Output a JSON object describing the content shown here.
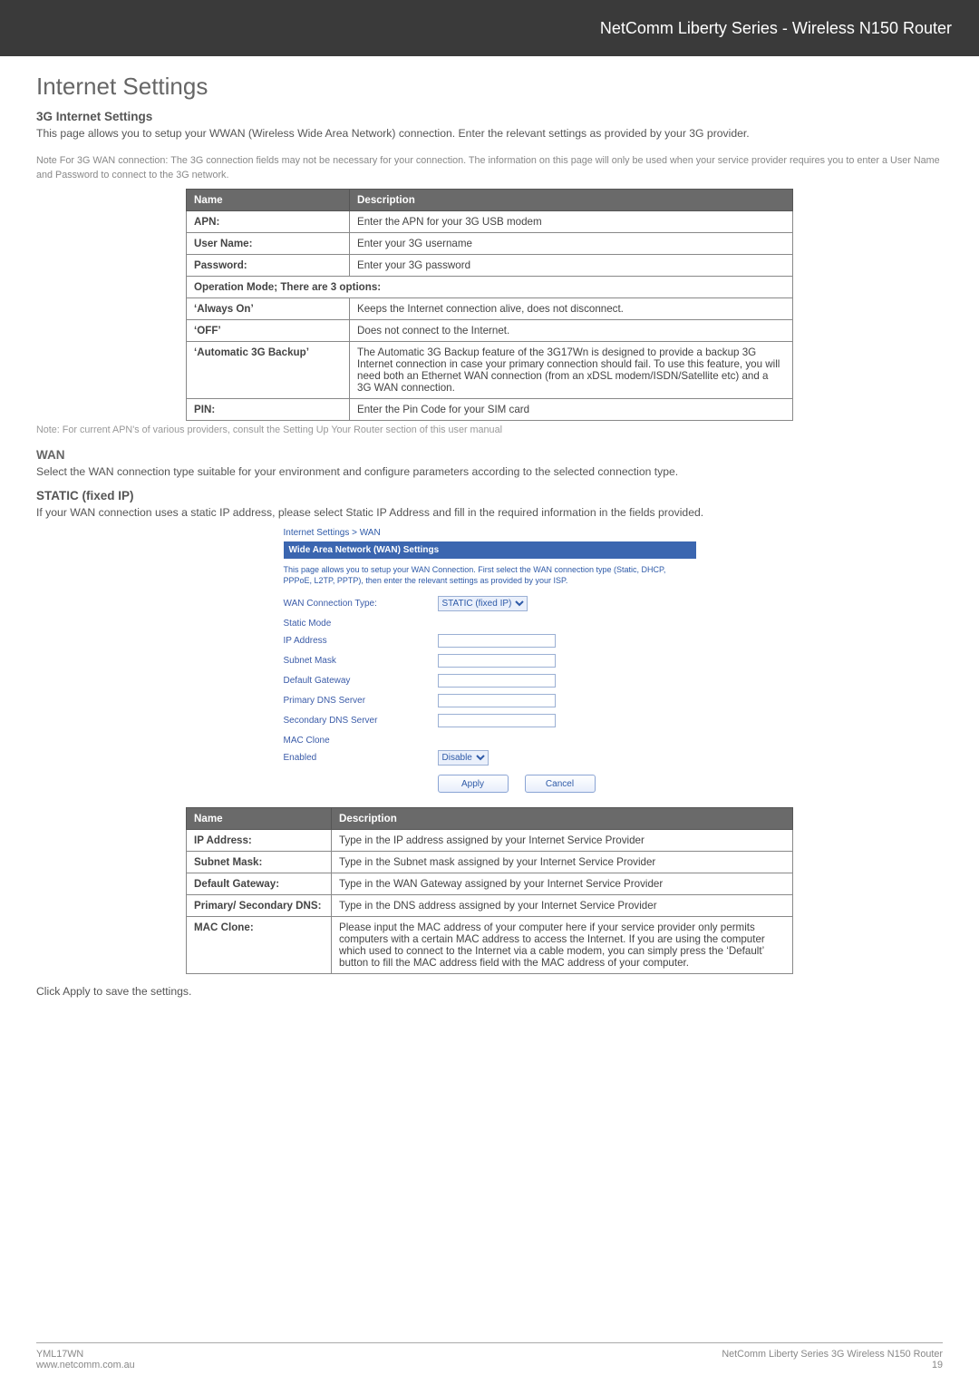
{
  "banner": {
    "title": "NetComm Liberty Series - Wireless N150 Router"
  },
  "h1": "Internet Settings",
  "sec_3g": {
    "title": "3G Internet Settings",
    "intro": "This page allows you to setup your WWAN (Wireless Wide Area Network) connection. Enter the relevant settings as provided by your 3G provider.",
    "note": "Note For 3G WAN connection: The 3G connection fields may not be necessary for your connection. The information on this page will only be used when your service provider requires you to enter a User Name and Password to connect to the 3G network."
  },
  "table1": {
    "head_name": "Name",
    "head_desc": "Description",
    "rows": [
      {
        "name": "APN:",
        "desc": "Enter the APN for your 3G USB modem"
      },
      {
        "name": "User Name:",
        "desc": "Enter your 3G username"
      },
      {
        "name": "Password:",
        "desc": "Enter your 3G password"
      }
    ],
    "span_row": "Operation Mode; There are 3 options:",
    "rows2": [
      {
        "name": "‘Always On’",
        "desc": "Keeps the Internet connection alive, does not disconnect."
      },
      {
        "name": "‘OFF’",
        "desc": "Does not connect to the Internet."
      },
      {
        "name": "‘Automatic 3G Backup’",
        "desc": "The Automatic 3G Backup feature of the 3G17Wn is designed to provide a backup 3G Internet connection in case your primary connection should fail. To use this feature, you will need both an Ethernet WAN connection (from an xDSL modem/ISDN/Satellite etc) and a 3G WAN connection."
      },
      {
        "name": "PIN:",
        "desc": "Enter the Pin Code for your SIM card"
      }
    ]
  },
  "note_apns": "Note: For current APN's of various providers, consult the Setting Up Your Router section of this user manual",
  "sec_wan": {
    "title": "WAN",
    "intro": "Select the WAN connection type suitable for your environment and configure parameters according to the selected connection type."
  },
  "sec_static": {
    "title": "STATIC (fixed IP)",
    "intro": "If your WAN connection uses a static IP address, please select Static IP Address and fill in the required information in the fields provided."
  },
  "shot": {
    "breadcrumb": "Internet Settings > WAN",
    "bar": "Wide Area Network (WAN) Settings",
    "intro": "This page allows you to setup your WAN Connection. First select the WAN connection type (Static, DHCP, PPPoE, L2TP, PPTP), then enter the relevant settings as provided by your ISP.",
    "rows": {
      "conn_type_lbl": "WAN Connection Type:",
      "conn_type_val": "STATIC (fixed IP)",
      "static_mode": "Static Mode",
      "ip": "IP Address",
      "subnet": "Subnet Mask",
      "gateway": "Default Gateway",
      "pdns": "Primary DNS Server",
      "sdns": "Secondary DNS Server",
      "mac_clone": "MAC Clone",
      "enabled_lbl": "Enabled",
      "enabled_val": "Disable"
    },
    "apply": "Apply",
    "cancel": "Cancel"
  },
  "table2": {
    "head_name": "Name",
    "head_desc": "Description",
    "rows": [
      {
        "name": "IP Address:",
        "desc": "Type in the IP address assigned by your Internet Service Provider"
      },
      {
        "name": "Subnet Mask:",
        "desc": "Type in the Subnet mask assigned by your Internet Service Provider"
      },
      {
        "name": "Default Gateway:",
        "desc": "Type in the WAN Gateway assigned by your Internet Service Provider"
      },
      {
        "name": "Primary/ Secondary DNS:",
        "desc": "Type in the DNS address assigned by your Internet Service Provider"
      },
      {
        "name": "MAC Clone:",
        "desc": "Please input the MAC address of your computer here if your service provider only permits computers with a certain MAC address to access the Internet. If you are using the computer which used to connect to the Internet via a cable modem, you can simply press the ‘Default’ button to fill the MAC address field with the MAC address of your computer."
      }
    ]
  },
  "apply_text": "Click Apply to save the settings.",
  "footer": {
    "left1": "YML17WN",
    "left2": "www.netcomm.com.au",
    "right1": "NetComm Liberty Series 3G Wireless N150 Router",
    "right2": "19"
  }
}
